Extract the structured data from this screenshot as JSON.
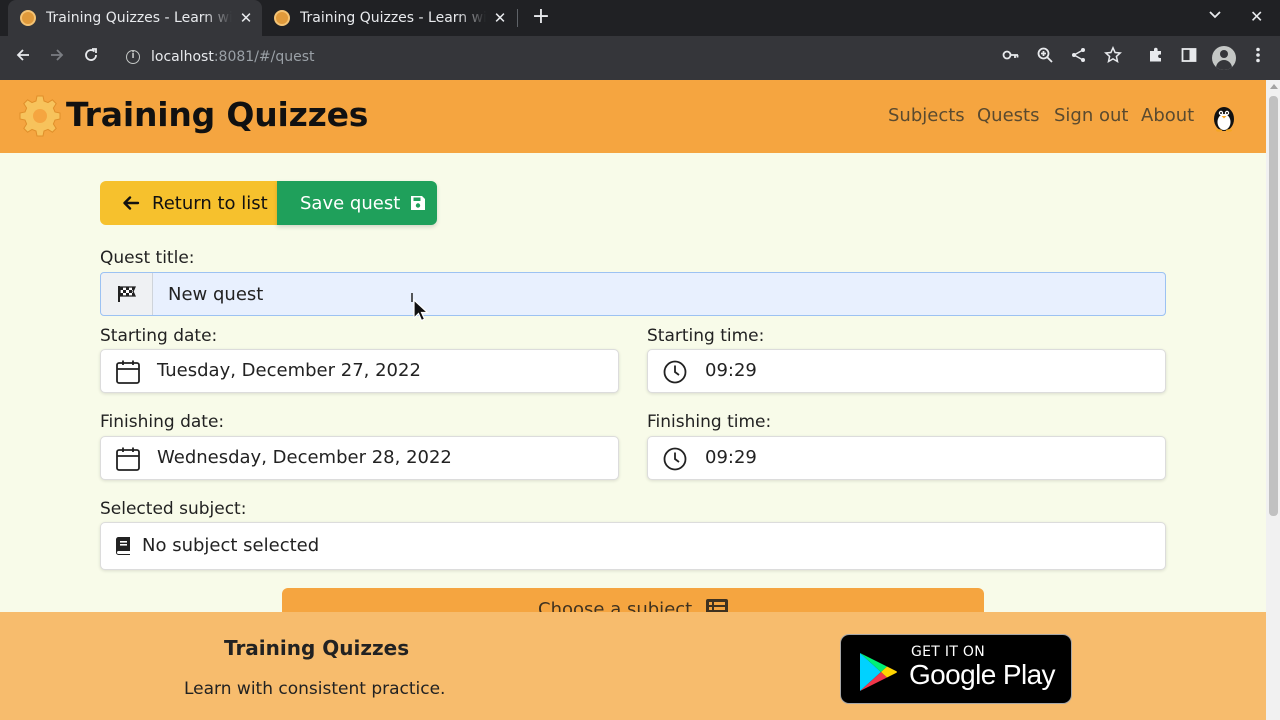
{
  "browser": {
    "tabs": [
      {
        "title": "Training Quizzes - Learn with consistent practice",
        "active": true
      },
      {
        "title": "Training Quizzes - Learn with consistent practice",
        "active": false
      }
    ],
    "url_host": "localhost",
    "url_rest": ":8081/#/quest"
  },
  "header": {
    "brand": "Training Quizzes",
    "nav": [
      "Subjects",
      "Quests",
      "Sign out",
      "About"
    ]
  },
  "actions": {
    "return_label": "Return to list",
    "save_label": "Save quest"
  },
  "form": {
    "quest_title_label": "Quest title:",
    "quest_title_value": "New quest",
    "start_date_label": "Starting date:",
    "start_date_value": "Tuesday, December 27, 2022",
    "start_time_label": "Starting time:",
    "start_time_value": "09:29",
    "finish_date_label": "Finishing date:",
    "finish_date_value": "Wednesday, December 28, 2022",
    "finish_time_label": "Finishing time:",
    "finish_time_value": "09:29",
    "subject_label": "Selected subject:",
    "subject_value": "No subject selected",
    "choose_subject_label": "Choose a subject"
  },
  "footer": {
    "title": "Training Quizzes",
    "tagline": "Learn with consistent practice.",
    "store_get": "GET IT ON",
    "store_name": "Google Play"
  },
  "colors": {
    "header_bg": "#f5a540",
    "page_bg": "#f8fbe9",
    "return_btn": "#f6c12d",
    "save_btn": "#1fa05b",
    "footer_bg": "#f7bc6d"
  }
}
